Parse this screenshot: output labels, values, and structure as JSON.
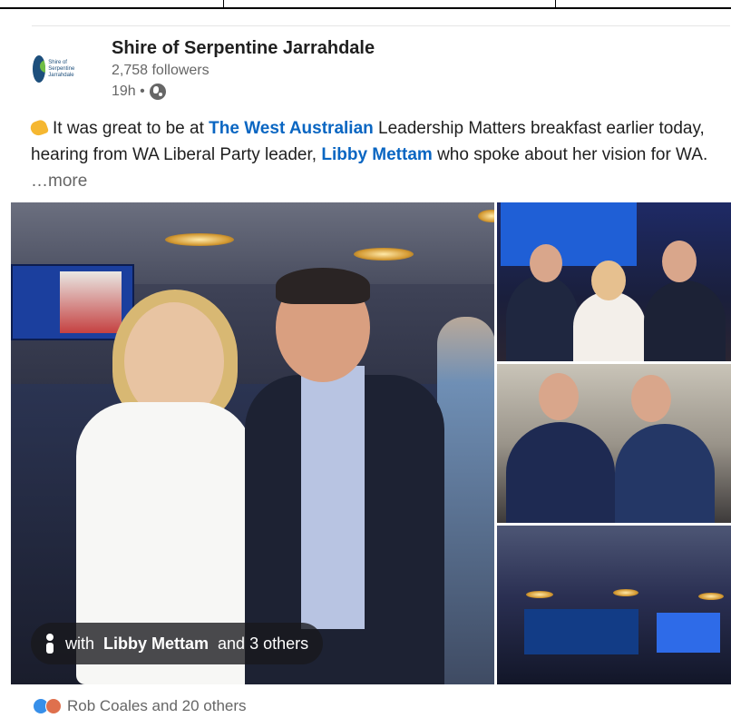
{
  "post": {
    "org_name": "Shire of Serpentine Jarrahdale",
    "logo_text": "Shire of Serpentine Jarrahdale",
    "followers": "2,758 followers",
    "time": "19h •",
    "body": {
      "part1": "It was great to be at ",
      "mention1": "The West Australian",
      "part2": " Leadership Matters breakfast earlier today, hearing from WA Liberal Party leader, ",
      "mention2": "Libby Mettam",
      "part3": " who spoke about her vision for WA.",
      "more": " …more"
    },
    "tag": {
      "prefix": "with",
      "name": "Libby Mettam",
      "suffix": "and 3 others"
    },
    "reactions": {
      "text": "Rob Coales and 20 others"
    }
  },
  "icons": [
    "clap-icon",
    "globe-icon",
    "person-icon",
    "like-icon",
    "support-icon"
  ],
  "colors": {
    "link": "#0a66c2",
    "muted": "#666666",
    "text": "#1f1f1f"
  }
}
